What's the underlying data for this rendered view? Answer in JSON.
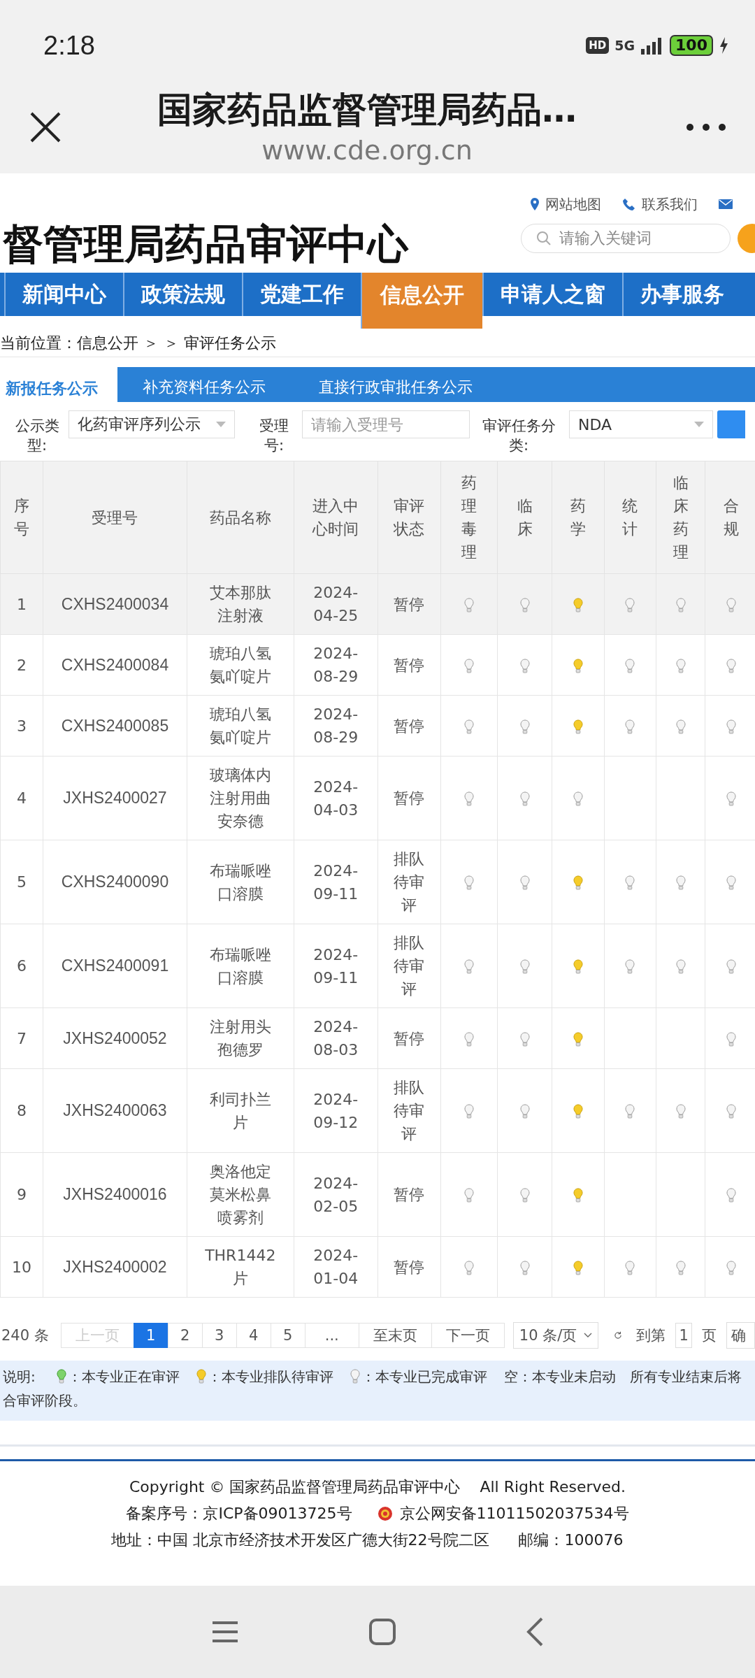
{
  "status_bar": {
    "time": "2:18",
    "hd": "HD",
    "network": "5G",
    "battery": "100"
  },
  "browser": {
    "title": "国家药品监督管理局药品…",
    "url": "www.cde.org.cn"
  },
  "site": {
    "top_links": [
      {
        "label": "网站地图",
        "kind": "pin"
      },
      {
        "label": "联系我们",
        "kind": "phone"
      }
    ],
    "title": "督管理局药品审评中心",
    "search": {
      "placeholder": "请输入关键词"
    }
  },
  "nav": [
    {
      "label": "新闻中心",
      "selected": false
    },
    {
      "label": "政策法规",
      "selected": false
    },
    {
      "label": "党建工作",
      "selected": false
    },
    {
      "label": "信息公开",
      "selected": true
    },
    {
      "label": "申请人之窗",
      "selected": false
    },
    {
      "label": "办事服务",
      "selected": false
    }
  ],
  "breadcrumb": "当前位置：信息公开 ＞ ＞ 审评任务公示",
  "tabs": [
    {
      "label": "新报任务公示",
      "selected": true
    },
    {
      "label": "补充资料任务公示",
      "selected": false
    },
    {
      "label": "直接行政审批任务公示",
      "selected": false
    }
  ],
  "filters": [
    {
      "label": "公示类型:",
      "kind": "select",
      "value": "化药审评序列公示"
    },
    {
      "label": "受理号:",
      "kind": "input",
      "placeholder": "请输入受理号"
    },
    {
      "label": "审评任务分类:",
      "kind": "select",
      "value": "NDA"
    }
  ],
  "table": {
    "columns": [
      "序号",
      "受理号",
      "药品名称",
      "进入中心时间",
      "审评状态",
      "药理毒理",
      "临床",
      "药学",
      "统计",
      "临床药理",
      "合规"
    ],
    "rows": [
      {
        "no": "1",
        "number": "CXHS2400034",
        "name": "艾本那肽注射液",
        "date": "2024-04-25",
        "status": "暂停",
        "highlighted": true,
        "lamps": [
          {
            "kind": "done"
          },
          {
            "kind": "done"
          },
          {
            "kind": "queued"
          },
          {
            "kind": "done"
          },
          {
            "kind": "done"
          },
          {
            "kind": "done"
          }
        ]
      },
      {
        "no": "2",
        "number": "CXHS2400084",
        "name": "琥珀八氢氨吖啶片",
        "date": "2024-08-29",
        "status": "暂停",
        "highlighted": false,
        "lamps": [
          {
            "kind": "done"
          },
          {
            "kind": "done"
          },
          {
            "kind": "queued"
          },
          {
            "kind": "done"
          },
          {
            "kind": "done"
          },
          {
            "kind": "done"
          }
        ]
      },
      {
        "no": "3",
        "number": "CXHS2400085",
        "name": "琥珀八氢氨吖啶片",
        "date": "2024-08-29",
        "status": "暂停",
        "highlighted": false,
        "lamps": [
          {
            "kind": "done"
          },
          {
            "kind": "done"
          },
          {
            "kind": "queued"
          },
          {
            "kind": "done"
          },
          {
            "kind": "done"
          },
          {
            "kind": "done"
          }
        ]
      },
      {
        "no": "4",
        "number": "JXHS2400027",
        "name": "玻璃体内注射用曲安奈德",
        "date": "2024-04-03",
        "status": "暂停",
        "highlighted": false,
        "lamps": [
          {
            "kind": "done"
          },
          {
            "kind": "done"
          },
          {
            "kind": "done"
          },
          {
            "kind": "none"
          },
          {
            "kind": "none"
          },
          {
            "kind": "done"
          }
        ]
      },
      {
        "no": "5",
        "number": "CXHS2400090",
        "name": "布瑞哌唑口溶膜",
        "date": "2024-09-11",
        "status": "排队待审评",
        "highlighted": false,
        "lamps": [
          {
            "kind": "done"
          },
          {
            "kind": "done"
          },
          {
            "kind": "queued"
          },
          {
            "kind": "done"
          },
          {
            "kind": "done"
          },
          {
            "kind": "done"
          }
        ]
      },
      {
        "no": "6",
        "number": "CXHS2400091",
        "name": "布瑞哌唑口溶膜",
        "date": "2024-09-11",
        "status": "排队待审评",
        "highlighted": false,
        "lamps": [
          {
            "kind": "done"
          },
          {
            "kind": "done"
          },
          {
            "kind": "queued"
          },
          {
            "kind": "done"
          },
          {
            "kind": "done"
          },
          {
            "kind": "done"
          }
        ]
      },
      {
        "no": "7",
        "number": "JXHS2400052",
        "name": "注射用头孢德罗",
        "date": "2024-08-03",
        "status": "暂停",
        "highlighted": false,
        "lamps": [
          {
            "kind": "done"
          },
          {
            "kind": "done"
          },
          {
            "kind": "queued"
          },
          {
            "kind": "none"
          },
          {
            "kind": "none"
          },
          {
            "kind": "done"
          }
        ]
      },
      {
        "no": "8",
        "number": "JXHS2400063",
        "name": "利司扑兰片",
        "date": "2024-09-12",
        "status": "排队待审评",
        "highlighted": false,
        "lamps": [
          {
            "kind": "done"
          },
          {
            "kind": "done"
          },
          {
            "kind": "queued"
          },
          {
            "kind": "done"
          },
          {
            "kind": "done"
          },
          {
            "kind": "done"
          }
        ]
      },
      {
        "no": "9",
        "number": "JXHS2400016",
        "name": "奥洛他定莫米松鼻喷雾剂",
        "date": "2024-02-05",
        "status": "暂停",
        "highlighted": false,
        "lamps": [
          {
            "kind": "done"
          },
          {
            "kind": "done"
          },
          {
            "kind": "queued"
          },
          {
            "kind": "none"
          },
          {
            "kind": "none"
          },
          {
            "kind": "done"
          }
        ]
      },
      {
        "no": "10",
        "number": "JXHS2400002",
        "name": "THR1442片",
        "date": "2024-01-04",
        "status": "暂停",
        "highlighted": false,
        "lamps": [
          {
            "kind": "done"
          },
          {
            "kind": "done"
          },
          {
            "kind": "queued"
          },
          {
            "kind": "done"
          },
          {
            "kind": "done"
          },
          {
            "kind": "done"
          }
        ]
      }
    ]
  },
  "pagination": {
    "total": "240 条",
    "prev": {
      "label": "上一页",
      "disabled": true
    },
    "pages": [
      {
        "label": "1",
        "selected": true
      },
      {
        "label": "2",
        "selected": false
      },
      {
        "label": "3",
        "selected": false
      },
      {
        "label": "4",
        "selected": false
      },
      {
        "label": "5",
        "selected": false
      }
    ],
    "ellipsis": "...",
    "last": "至末页",
    "next": "下一页",
    "page_size": "10 条/页",
    "goto_label": "到第",
    "goto_value": "1",
    "page_unit": "页",
    "confirm": "确"
  },
  "legend": {
    "label": "说明:",
    "items": [
      {
        "kind": "active",
        "text": "：本专业正在审评"
      },
      {
        "kind": "queued",
        "text": "：本专业排队待审评"
      },
      {
        "kind": "done",
        "text": "：本专业已完成审评"
      }
    ],
    "empty_text": "空：本专业未启动",
    "note": "所有专业结束后将",
    "note_line2": "合审评阶段。"
  },
  "footer": {
    "copyright": "Copyright © 国家药品监督管理局药品审评中心    All Right Reserved.",
    "icp": "备案序号：京ICP备09013725号",
    "police": "京公网安备11011502037534号",
    "address": "地址：中国 北京市经济技术开发区广德大街22号院二区      邮编：100076"
  }
}
